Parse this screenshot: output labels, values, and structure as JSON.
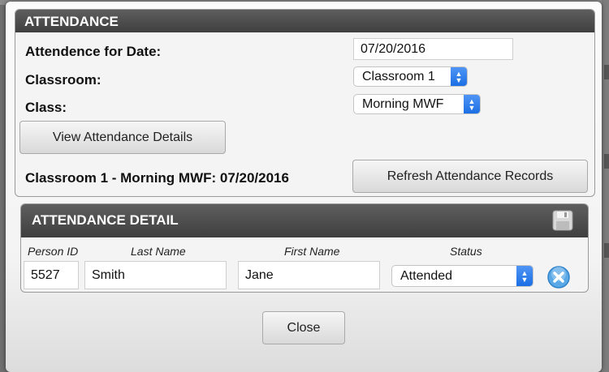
{
  "attendance": {
    "header": "ATTENDANCE",
    "date_label": "Attendence for Date:",
    "date_value": "07/20/2016",
    "classroom_label": "Classroom:",
    "classroom_selected": "Classroom 1",
    "class_label": "Class:",
    "class_selected": "Morning MWF",
    "view_button": "View Attendance Details",
    "summary": "Classroom 1 - Morning MWF: 07/20/2016",
    "refresh_button": "Refresh Attendance Records"
  },
  "detail": {
    "header": "ATTENDANCE DETAIL",
    "save_icon": "floppy-disk-icon",
    "columns": [
      "Person ID",
      "Last Name",
      "First Name",
      "Status"
    ],
    "rows": [
      {
        "person_id": "5527",
        "last_name": "Smith",
        "first_name": "Jane",
        "status": "Attended",
        "remove_icon": "remove-x-icon"
      }
    ]
  },
  "footer": {
    "close_button": "Close"
  },
  "colors": {
    "header_bg": "#4a4a4a",
    "select_arrow": "#2a7af0",
    "remove_icon": "#5aa9e6"
  }
}
